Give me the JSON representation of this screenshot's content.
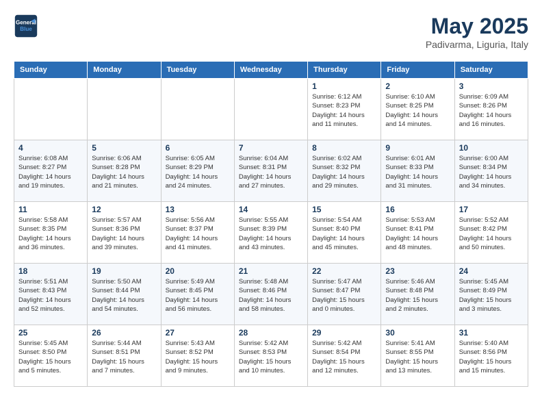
{
  "header": {
    "logo_line1": "General",
    "logo_line2": "Blue",
    "month": "May 2025",
    "location": "Padivarma, Liguria, Italy"
  },
  "days_of_week": [
    "Sunday",
    "Monday",
    "Tuesday",
    "Wednesday",
    "Thursday",
    "Friday",
    "Saturday"
  ],
  "weeks": [
    [
      {
        "day": "",
        "info": ""
      },
      {
        "day": "",
        "info": ""
      },
      {
        "day": "",
        "info": ""
      },
      {
        "day": "",
        "info": ""
      },
      {
        "day": "1",
        "info": "Sunrise: 6:12 AM\nSunset: 8:23 PM\nDaylight: 14 hours\nand 11 minutes."
      },
      {
        "day": "2",
        "info": "Sunrise: 6:10 AM\nSunset: 8:25 PM\nDaylight: 14 hours\nand 14 minutes."
      },
      {
        "day": "3",
        "info": "Sunrise: 6:09 AM\nSunset: 8:26 PM\nDaylight: 14 hours\nand 16 minutes."
      }
    ],
    [
      {
        "day": "4",
        "info": "Sunrise: 6:08 AM\nSunset: 8:27 PM\nDaylight: 14 hours\nand 19 minutes."
      },
      {
        "day": "5",
        "info": "Sunrise: 6:06 AM\nSunset: 8:28 PM\nDaylight: 14 hours\nand 21 minutes."
      },
      {
        "day": "6",
        "info": "Sunrise: 6:05 AM\nSunset: 8:29 PM\nDaylight: 14 hours\nand 24 minutes."
      },
      {
        "day": "7",
        "info": "Sunrise: 6:04 AM\nSunset: 8:31 PM\nDaylight: 14 hours\nand 27 minutes."
      },
      {
        "day": "8",
        "info": "Sunrise: 6:02 AM\nSunset: 8:32 PM\nDaylight: 14 hours\nand 29 minutes."
      },
      {
        "day": "9",
        "info": "Sunrise: 6:01 AM\nSunset: 8:33 PM\nDaylight: 14 hours\nand 31 minutes."
      },
      {
        "day": "10",
        "info": "Sunrise: 6:00 AM\nSunset: 8:34 PM\nDaylight: 14 hours\nand 34 minutes."
      }
    ],
    [
      {
        "day": "11",
        "info": "Sunrise: 5:58 AM\nSunset: 8:35 PM\nDaylight: 14 hours\nand 36 minutes."
      },
      {
        "day": "12",
        "info": "Sunrise: 5:57 AM\nSunset: 8:36 PM\nDaylight: 14 hours\nand 39 minutes."
      },
      {
        "day": "13",
        "info": "Sunrise: 5:56 AM\nSunset: 8:37 PM\nDaylight: 14 hours\nand 41 minutes."
      },
      {
        "day": "14",
        "info": "Sunrise: 5:55 AM\nSunset: 8:39 PM\nDaylight: 14 hours\nand 43 minutes."
      },
      {
        "day": "15",
        "info": "Sunrise: 5:54 AM\nSunset: 8:40 PM\nDaylight: 14 hours\nand 45 minutes."
      },
      {
        "day": "16",
        "info": "Sunrise: 5:53 AM\nSunset: 8:41 PM\nDaylight: 14 hours\nand 48 minutes."
      },
      {
        "day": "17",
        "info": "Sunrise: 5:52 AM\nSunset: 8:42 PM\nDaylight: 14 hours\nand 50 minutes."
      }
    ],
    [
      {
        "day": "18",
        "info": "Sunrise: 5:51 AM\nSunset: 8:43 PM\nDaylight: 14 hours\nand 52 minutes."
      },
      {
        "day": "19",
        "info": "Sunrise: 5:50 AM\nSunset: 8:44 PM\nDaylight: 14 hours\nand 54 minutes."
      },
      {
        "day": "20",
        "info": "Sunrise: 5:49 AM\nSunset: 8:45 PM\nDaylight: 14 hours\nand 56 minutes."
      },
      {
        "day": "21",
        "info": "Sunrise: 5:48 AM\nSunset: 8:46 PM\nDaylight: 14 hours\nand 58 minutes."
      },
      {
        "day": "22",
        "info": "Sunrise: 5:47 AM\nSunset: 8:47 PM\nDaylight: 15 hours\nand 0 minutes."
      },
      {
        "day": "23",
        "info": "Sunrise: 5:46 AM\nSunset: 8:48 PM\nDaylight: 15 hours\nand 2 minutes."
      },
      {
        "day": "24",
        "info": "Sunrise: 5:45 AM\nSunset: 8:49 PM\nDaylight: 15 hours\nand 3 minutes."
      }
    ],
    [
      {
        "day": "25",
        "info": "Sunrise: 5:45 AM\nSunset: 8:50 PM\nDaylight: 15 hours\nand 5 minutes."
      },
      {
        "day": "26",
        "info": "Sunrise: 5:44 AM\nSunset: 8:51 PM\nDaylight: 15 hours\nand 7 minutes."
      },
      {
        "day": "27",
        "info": "Sunrise: 5:43 AM\nSunset: 8:52 PM\nDaylight: 15 hours\nand 9 minutes."
      },
      {
        "day": "28",
        "info": "Sunrise: 5:42 AM\nSunset: 8:53 PM\nDaylight: 15 hours\nand 10 minutes."
      },
      {
        "day": "29",
        "info": "Sunrise: 5:42 AM\nSunset: 8:54 PM\nDaylight: 15 hours\nand 12 minutes."
      },
      {
        "day": "30",
        "info": "Sunrise: 5:41 AM\nSunset: 8:55 PM\nDaylight: 15 hours\nand 13 minutes."
      },
      {
        "day": "31",
        "info": "Sunrise: 5:40 AM\nSunset: 8:56 PM\nDaylight: 15 hours\nand 15 minutes."
      }
    ]
  ]
}
